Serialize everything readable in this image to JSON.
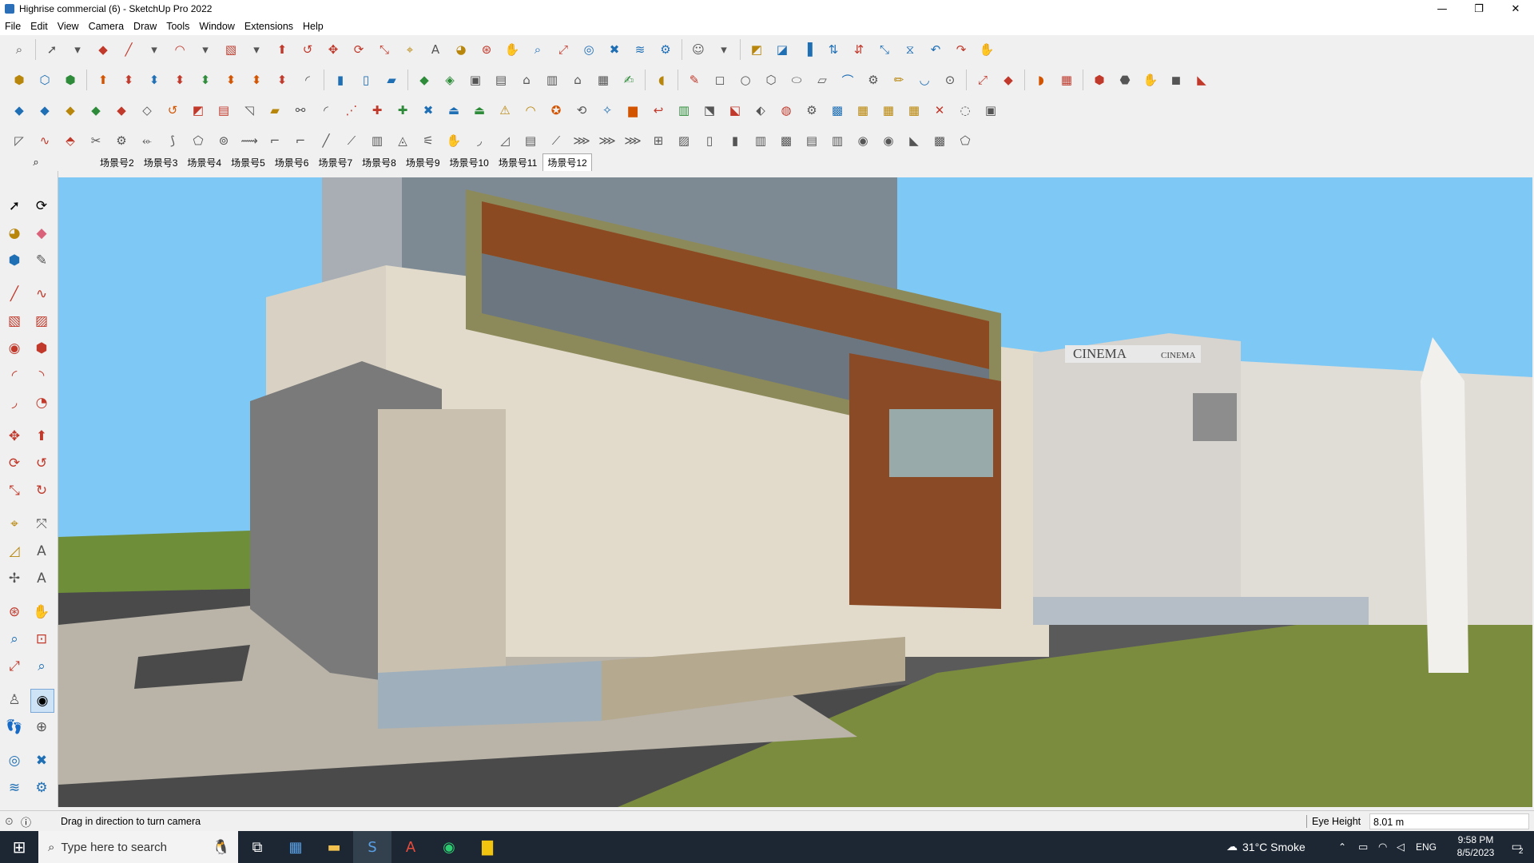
{
  "window": {
    "title": "Highrise commercial (6) - SketchUp Pro 2022",
    "minimize": "—",
    "maximize": "❐",
    "close": "✕"
  },
  "menu": [
    "File",
    "Edit",
    "View",
    "Camera",
    "Draw",
    "Tools",
    "Window",
    "Extensions",
    "Help"
  ],
  "scenes": {
    "search_icon": "⌕",
    "items": [
      "场景号2",
      "场景号3",
      "场景号4",
      "场景号5",
      "场景号6",
      "场景号7",
      "场景号8",
      "场景号9",
      "场景号10",
      "场景号11",
      "场景号12"
    ],
    "active": "场景号12"
  },
  "viewport": {
    "signage_left": "CINEMA",
    "signage_right": "CINEMA"
  },
  "status": {
    "message": "Drag in direction to turn camera",
    "measure_label": "Eye Height",
    "measure_value": "8.01 m"
  },
  "taskbar": {
    "search_placeholder": "Type here to search",
    "weather": "31°C  Smoke",
    "lang": "ENG",
    "time": "9:58 PM",
    "date": "8/5/2023",
    "notifications": "2"
  },
  "colors": {
    "sky": "#7ec8f5",
    "ground": "#7b8c3f",
    "road": "#4a4a4a",
    "accent": "#1f6fb5"
  }
}
